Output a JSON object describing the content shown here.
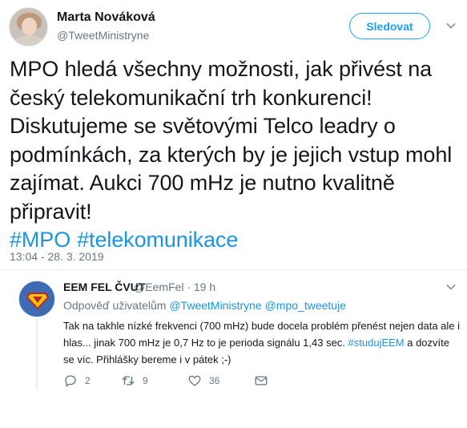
{
  "main_tweet": {
    "author_name": "Marta Nováková",
    "author_handle": "@TweetMinistryne",
    "follow_label": "Sledovat",
    "text": "MPO hledá všechny možnosti, jak přivést na český telekomunikační trh konkurenci! Diskutujeme se světovými Telco leadry o podmínkách, za kterých by je jejich vstup mohl zajímat. Aukci 700 mHz je nutno kvalitně připravit!",
    "hashtags": [
      "#MPO",
      "#telekomunikace"
    ],
    "timestamp": "13:04 - 28. 3. 2019"
  },
  "reply": {
    "author_name": "EEM FEL ČVUT",
    "author_meta": "@EemFel · 19 h",
    "reply_to_prefix": "Odpověď uživatelům",
    "reply_to_users": [
      "@TweetMinistryne",
      "@mpo_tweetuje"
    ],
    "text_before": "Tak na takhle nízké frekvenci (700 mHz) bude docela problém přenést nejen data ale i hlas... jinak 700 mHz je 0,7 Hz to je perioda signálu 1,43 sec. ",
    "hashtag": "#studujEEM",
    "text_after": " a dozvíte se víc.  Přihlášky bereme i v pátek ;-)",
    "reply_count": "2",
    "retweet_count": "9",
    "like_count": "36"
  },
  "colors": {
    "link": "#1b95e0",
    "follow": "#1da1f2",
    "secondary_text": "#657786",
    "primary_text": "#14171a"
  },
  "icons": [
    "chevron-down-icon",
    "reply-icon",
    "retweet-icon",
    "like-icon",
    "direct-message-icon"
  ]
}
